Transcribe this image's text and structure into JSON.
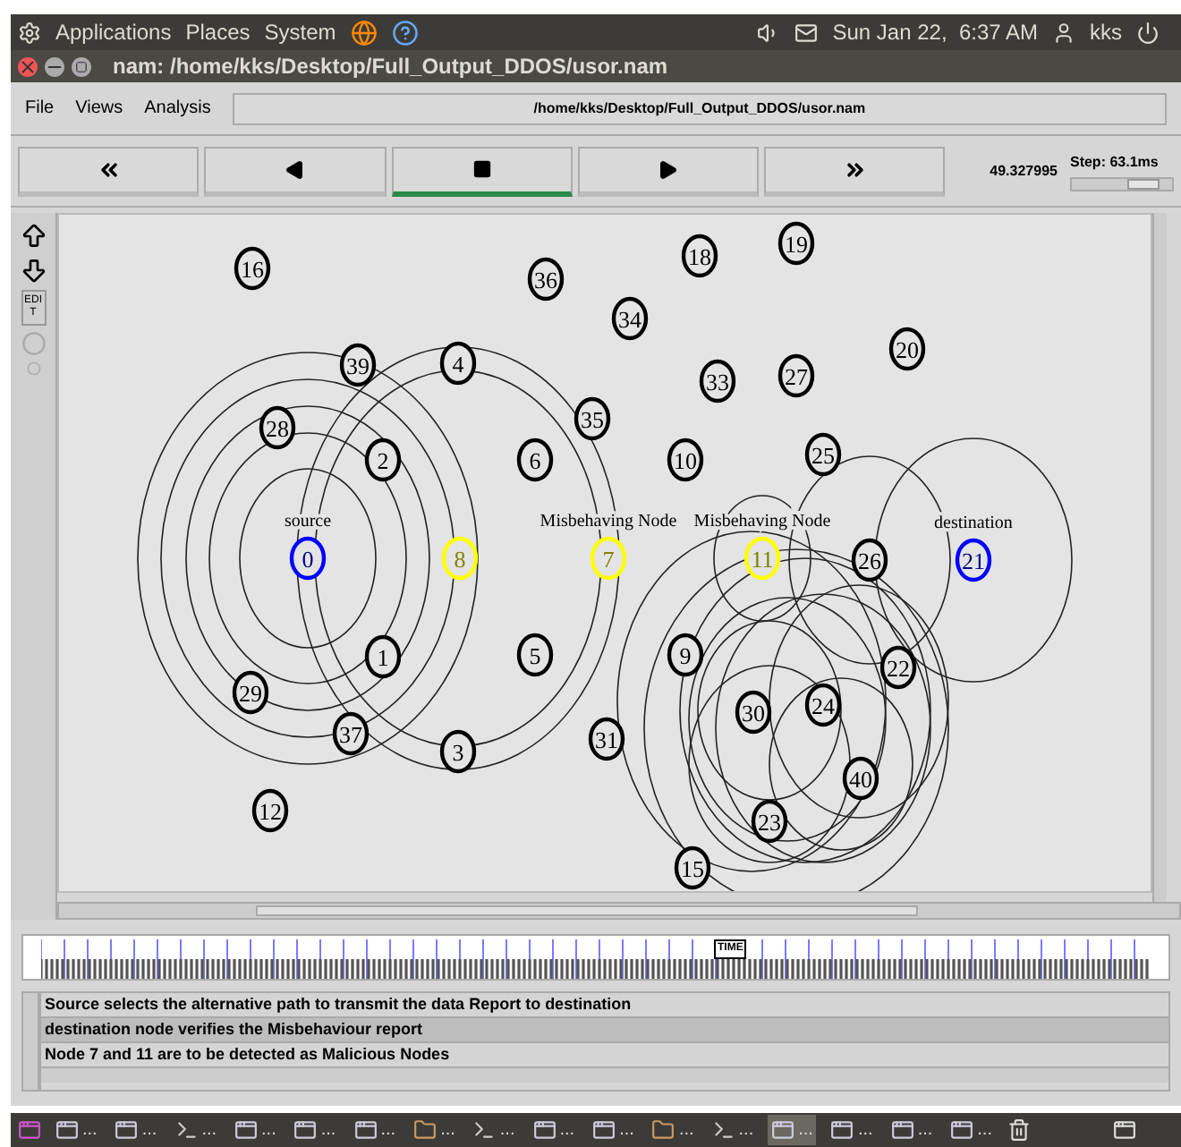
{
  "top_panel": {
    "menus": [
      "Applications",
      "Places",
      "System"
    ],
    "clock": "Sun Jan 22,  6:37 AM",
    "user": "kks"
  },
  "window": {
    "title": "nam: /home/kks/Desktop/Full_Output_DDOS/usor.nam"
  },
  "menu_bar": {
    "items": [
      "File",
      "Views",
      "Analysis"
    ],
    "path": "/home/kks/Desktop/Full_Output_DDOS/usor.nam"
  },
  "controls": {
    "buttons": [
      {
        "kind": "rewind",
        "selected": false
      },
      {
        "kind": "back",
        "selected": false
      },
      {
        "kind": "stop",
        "selected": true
      },
      {
        "kind": "play",
        "selected": false
      },
      {
        "kind": "forward",
        "selected": false
      }
    ],
    "time": "49.327995",
    "step": "Step: 63.1ms"
  },
  "side_tools": {
    "edit": "EDIT"
  },
  "nodes": [
    {
      "label": "16",
      "color": "#000000"
    },
    {
      "label": "36",
      "color": "#000000"
    },
    {
      "label": "18",
      "color": "#000000"
    },
    {
      "label": "19",
      "color": "#000000"
    },
    {
      "label": "34",
      "color": "#000000"
    },
    {
      "label": "20",
      "color": "#000000"
    },
    {
      "label": "33",
      "color": "#000000"
    },
    {
      "label": "27",
      "color": "#000000"
    },
    {
      "label": "39",
      "color": "#000000"
    },
    {
      "label": "4",
      "color": "#000000"
    },
    {
      "label": "28",
      "color": "#000000"
    },
    {
      "label": "35",
      "color": "#000000"
    },
    {
      "label": "2",
      "color": "#000000"
    },
    {
      "label": "6",
      "color": "#000000"
    },
    {
      "label": "10",
      "color": "#000000"
    },
    {
      "label": "25",
      "color": "#000000"
    },
    {
      "label": "0",
      "color": "#0000ff",
      "caption": "source"
    },
    {
      "label": "8",
      "color": "#ffff00"
    },
    {
      "label": "7",
      "color": "#ffff00",
      "caption": "Misbehaving Node"
    },
    {
      "label": "11",
      "color": "#ffff00",
      "caption": "Misbehaving Node"
    },
    {
      "label": "26",
      "color": "#000000"
    },
    {
      "label": "21",
      "color": "#0000ff",
      "caption": "destination"
    },
    {
      "label": "1",
      "color": "#000000"
    },
    {
      "label": "5",
      "color": "#000000"
    },
    {
      "label": "9",
      "color": "#000000"
    },
    {
      "label": "22",
      "color": "#000000"
    },
    {
      "label": "29",
      "color": "#000000"
    },
    {
      "label": "37",
      "color": "#000000"
    },
    {
      "label": "3",
      "color": "#000000"
    },
    {
      "label": "31",
      "color": "#000000"
    },
    {
      "label": "30",
      "color": "#000000"
    },
    {
      "label": "24",
      "color": "#000000"
    },
    {
      "label": "40",
      "color": "#000000"
    },
    {
      "label": "12",
      "color": "#000000"
    },
    {
      "label": "23",
      "color": "#000000"
    },
    {
      "label": "15",
      "color": "#000000"
    }
  ],
  "timeline": {
    "marker": "TIME"
  },
  "annotations": [
    {
      "text": "Source selects the alternative path to transmit the data Report to destination",
      "selected": false
    },
    {
      "text": "destination node verifies the Misbehaviour report",
      "selected": true
    },
    {
      "text": "Node 7 and 11 are to be detected as Malicious Nodes",
      "selected": false
    }
  ],
  "taskbar": {
    "items": [
      {
        "kind": "window",
        "label": "...",
        "selected": false
      },
      {
        "kind": "window",
        "label": "...",
        "selected": false
      },
      {
        "kind": "terminal",
        "label": "...",
        "selected": false
      },
      {
        "kind": "window",
        "label": "...",
        "selected": false
      },
      {
        "kind": "window",
        "label": "...",
        "selected": false
      },
      {
        "kind": "window",
        "label": "...",
        "selected": false
      },
      {
        "kind": "folder",
        "label": "...",
        "selected": false
      },
      {
        "kind": "terminal",
        "label": "...",
        "selected": false
      },
      {
        "kind": "window",
        "label": "...",
        "selected": false
      },
      {
        "kind": "window",
        "label": "...",
        "selected": false
      },
      {
        "kind": "folder",
        "label": "...",
        "selected": false
      },
      {
        "kind": "terminal",
        "label": "...",
        "selected": false
      },
      {
        "kind": "window",
        "label": "...",
        "selected": true
      },
      {
        "kind": "window",
        "label": "...",
        "selected": false
      },
      {
        "kind": "window",
        "label": "...",
        "selected": false
      },
      {
        "kind": "window",
        "label": "...",
        "selected": false
      }
    ]
  }
}
